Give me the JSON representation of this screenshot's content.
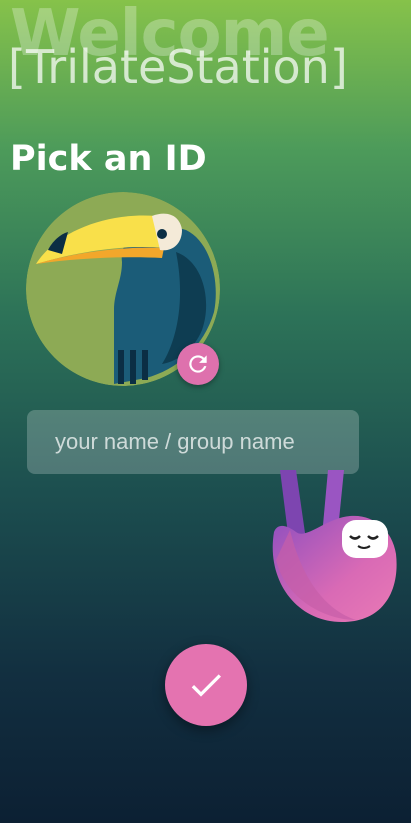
{
  "header": {
    "welcome_text": "Welcome",
    "app_name": "[TrilateStation]"
  },
  "main": {
    "heading": "Pick an ID",
    "avatar_icon": "toucan-avatar-icon",
    "refresh_icon": "refresh-icon",
    "name_field": {
      "placeholder": "your name / group name",
      "value": ""
    },
    "mascot_icon": "sloth-icon",
    "confirm_icon": "checkmark-icon"
  },
  "colors": {
    "accent_pink": "#e473b0",
    "gradient_top": "#86c24a",
    "gradient_bottom": "#0c2033"
  }
}
